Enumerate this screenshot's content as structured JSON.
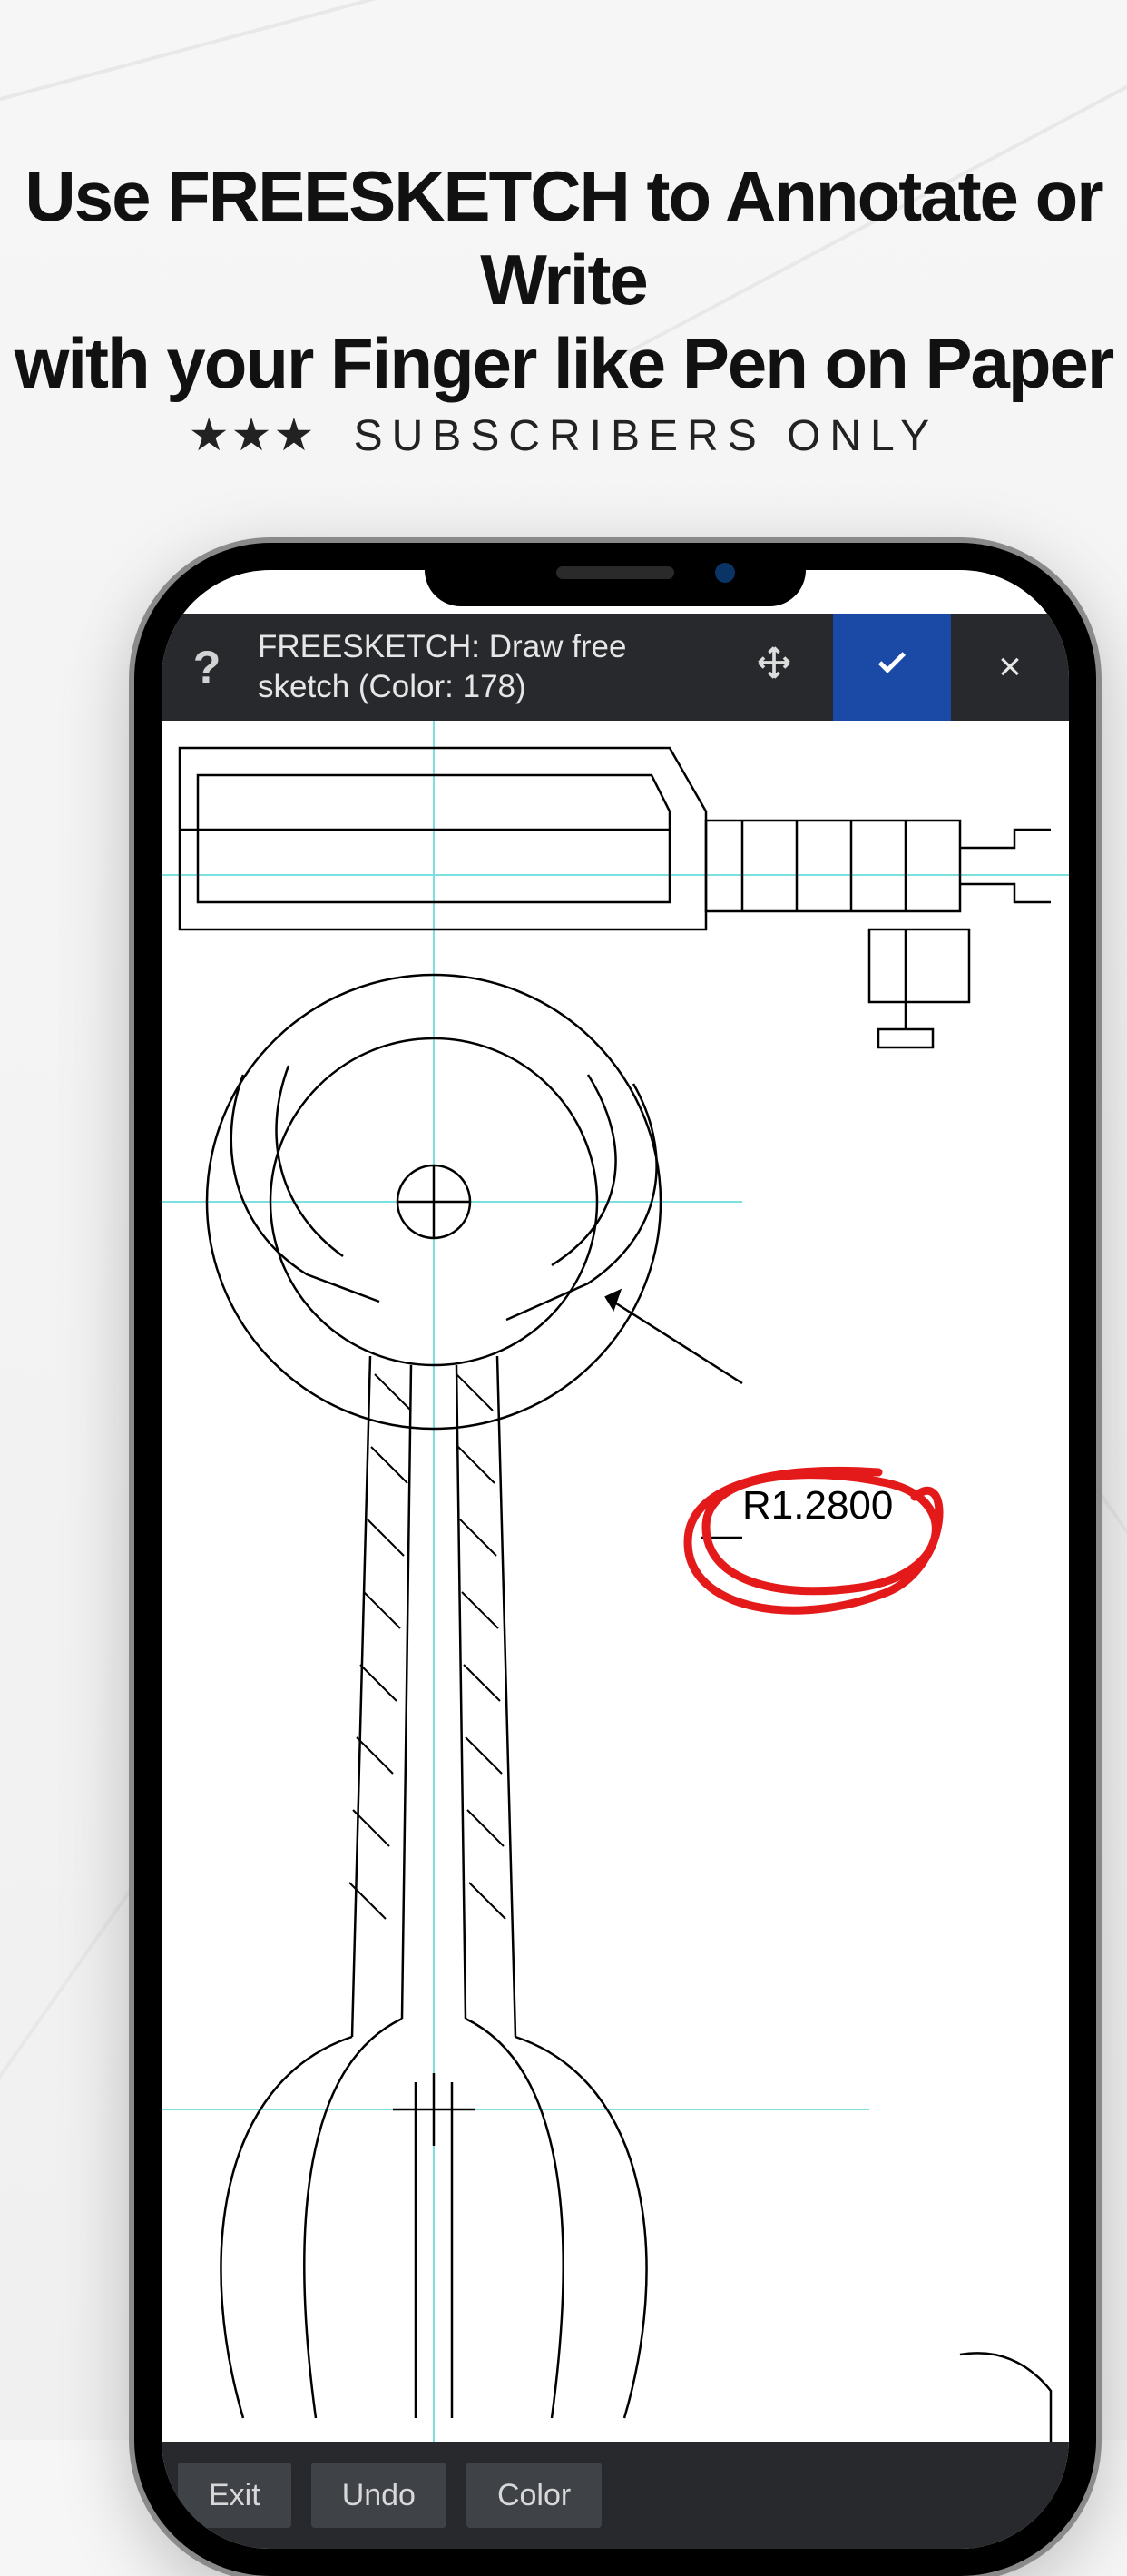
{
  "promo": {
    "headline_line1": "Use FREESKETCH to Annotate or Write",
    "headline_line2": "with your Finger like Pen on Paper",
    "stars": "★★★",
    "subscribers_label": "SUBSCRIBERS ONLY"
  },
  "toolbar": {
    "help_symbol": "?",
    "title_line1": "FREESKETCH: Draw free",
    "title_line2": "sketch (Color: 178)",
    "close_symbol": "×"
  },
  "annotation": {
    "dimension_label": "R1.2800",
    "stroke_color": "#e41a1a"
  },
  "bottombar": {
    "exit": "Exit",
    "undo": "Undo",
    "color": "Color"
  },
  "theme": {
    "toolbar_bg": "#27292c",
    "confirm_bg": "#1b4aa6",
    "btn_bg": "#3f4246",
    "canvas_bg": "#ffffff",
    "guide_color": "#66e0e0"
  }
}
